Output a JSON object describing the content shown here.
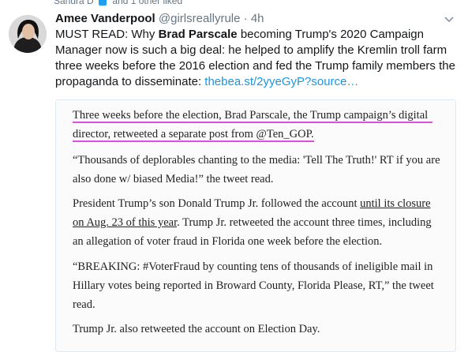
{
  "social_context": {
    "text": "Sandra D",
    "more": "and 1 other liked"
  },
  "tweet": {
    "author_name": "Amee Vanderpool",
    "handle": "@girlsreallyrule",
    "dot": "·",
    "time": "4h",
    "text_1": "MUST READ: Why ",
    "bold_name": "Brad Parscale",
    "text_2": " becoming Trump's 2020 Campaign Manager now is such a big deal: he helped to amplify the Kremlin troll farm three weeks before the 2016 election and fed the Trump family members the propaganda to disseminate: ",
    "link": "thebea.st/2yyeGyP?source…"
  },
  "card": {
    "p1": "Three weeks before the election, Brad Parscale, the Trump campaign’s digital director, retweeted a separate post from @Ten_GOP.",
    "p2": "“Thousands of deplorables chanting to the media: 'Tell The Truth!' RT if you are also done w/ biased Media!” the tweet read.",
    "p3_a": "President Trump’s son Donald Trump Jr. followed the account ",
    "p3_link": "until its closure on Aug. 23 of this year",
    "p3_b": ". Trump Jr. retweeted the account three times, including an allegation of voter fraud in Florida one week before the election.",
    "p4": "“BREAKING: #VoterFraud by counting tens of thousands of ineligible mail in Hillary votes being reported in Broward County, Florida Please, RT,” the tweet read.",
    "p5": "Trump Jr. also retweeted the account on Election Day."
  },
  "colors": {
    "link": "#1b95e0",
    "highlight": "#e04ee0",
    "muted": "#657786"
  },
  "icons": {
    "caret": "chevron-down-icon",
    "social": "twitter-bird-icon"
  }
}
